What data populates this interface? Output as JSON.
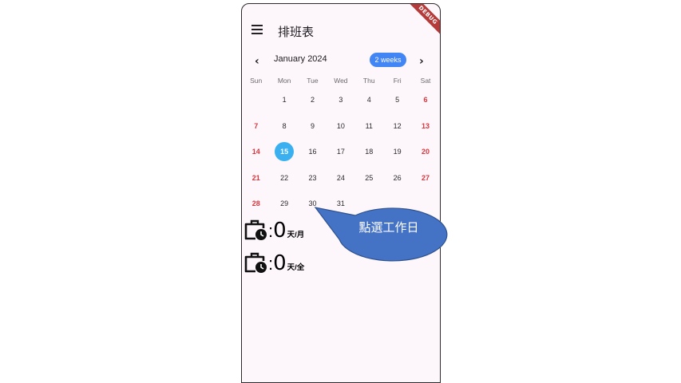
{
  "app": {
    "title": "排班表",
    "debug_banner": "DEBUG"
  },
  "calendar": {
    "month_label": "January 2024",
    "format_button": "2 weeks",
    "prev_icon": "chevron-left-icon",
    "next_icon": "chevron-right-icon",
    "weekdays": [
      "Sun",
      "Mon",
      "Tue",
      "Wed",
      "Thu",
      "Fri",
      "Sat"
    ],
    "weeks": [
      [
        "",
        "1",
        "2",
        "3",
        "4",
        "5",
        "6"
      ],
      [
        "7",
        "8",
        "9",
        "10",
        "11",
        "12",
        "13"
      ],
      [
        "14",
        "15",
        "16",
        "17",
        "18",
        "19",
        "20"
      ],
      [
        "21",
        "22",
        "23",
        "24",
        "25",
        "26",
        "27"
      ],
      [
        "28",
        "29",
        "30",
        "31",
        "",
        "",
        ""
      ]
    ],
    "selected_day": "15",
    "weekend_color": "#d9363e",
    "selected_color": "#3ab0f0",
    "accent_color": "#4285f4"
  },
  "stats": {
    "month": {
      "icon": "work-history-icon",
      "colon": ":",
      "value": "0",
      "unit": "天/月"
    },
    "total": {
      "icon": "work-history-icon",
      "colon": ":",
      "value": "0",
      "unit": "天/全"
    }
  },
  "annotation": {
    "text": "點選工作日",
    "fill_color": "#4472c4"
  }
}
